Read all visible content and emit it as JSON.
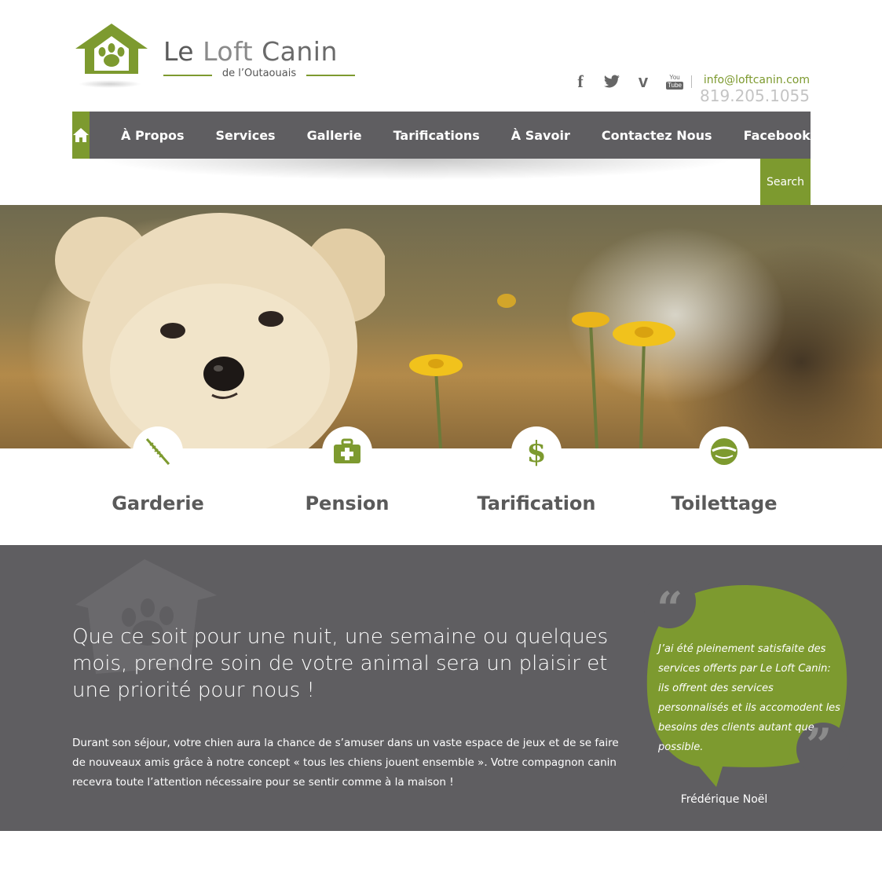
{
  "brand": {
    "title_part1": "Le",
    "title_part2": "Loft",
    "title_part3": "Canin",
    "subtitle": "de l’Outaouais",
    "accent_color": "#7d9a2f",
    "dark_color": "#5f5e61"
  },
  "header": {
    "social": [
      {
        "name": "facebook-icon",
        "glyph": "f"
      },
      {
        "name": "twitter-icon",
        "glyph": ""
      },
      {
        "name": "vimeo-icon",
        "glyph": "v"
      },
      {
        "name": "youtube-icon",
        "glyph_top": "You",
        "glyph_bottom": "Tube"
      }
    ],
    "email": "info@loftcanin.com",
    "phone": "819.205.1055"
  },
  "nav": {
    "home_icon": "home-icon",
    "items": [
      "À Propos",
      "Services",
      "Gallerie",
      "Tarifications",
      "À Savoir",
      "Contactez Nous",
      "Facebook"
    ],
    "search_label": "Search"
  },
  "features": [
    {
      "label": "Garderie",
      "icon": "brush-icon"
    },
    {
      "label": "Pension",
      "icon": "medical-kit-icon"
    },
    {
      "label": "Tarification",
      "icon": "dollar-icon"
    },
    {
      "label": "Toilettage",
      "icon": "food-bowl-icon"
    }
  ],
  "about": {
    "headline": "Que ce soit pour une nuit, une semaine ou quelques mois, prendre soin de votre animal sera un plaisir et une priorité pour nous !",
    "body": "Durant son séjour, votre chien aura la chance de s’amuser dans un vaste espace de jeux et de se faire de nouveaux amis grâce à notre concept « tous les chiens jouent ensemble ». Votre compagnon canin recevra toute l’attention nécessaire pour se sentir comme à la maison !"
  },
  "testimonial": {
    "quote": "J’ai été pleinement satisfaite des services offerts par Le Loft Canin: ils offrent des services personnalisés et ils accomodent les besoins des clients autant que possible.",
    "author": "Frédérique Noël",
    "open_mark": "“",
    "close_mark": "”"
  }
}
